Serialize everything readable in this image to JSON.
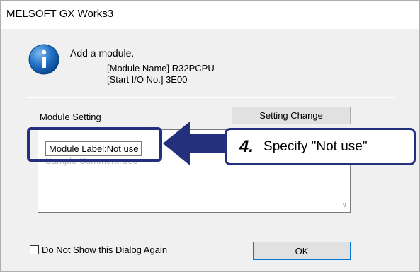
{
  "window": {
    "title": "MELSOFT GX Works3"
  },
  "message": {
    "heading": "Add a module.",
    "module_name_line": "[Module Name]  R32PCPU",
    "start_io_line": "[Start I/O No.]  3E00"
  },
  "module_setting": {
    "label": "Module Setting",
    "change_button": "Setting Change",
    "list_item": "Module Label:Not use",
    "list_item_ghost": "Sample Comment:Use"
  },
  "footer": {
    "checkbox_label": "Do Not Show this Dialog Again",
    "checkbox_checked": false,
    "ok_button": "OK"
  },
  "callout": {
    "step": "4.",
    "text": "Specify \"Not use\"",
    "color": "#23307c"
  }
}
